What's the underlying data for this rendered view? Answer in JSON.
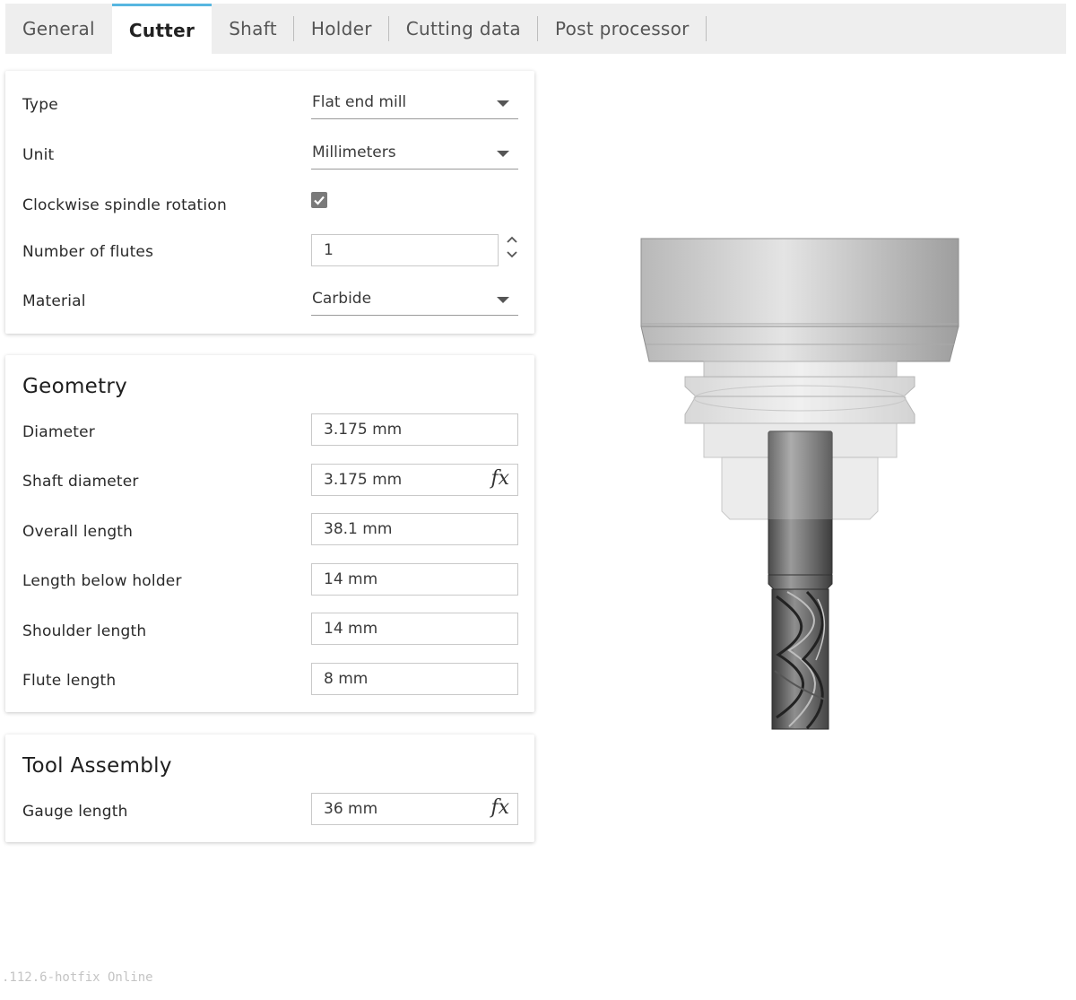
{
  "tabs": [
    {
      "label": "General"
    },
    {
      "label": "Cutter"
    },
    {
      "label": "Shaft"
    },
    {
      "label": "Holder"
    },
    {
      "label": "Cutting data"
    },
    {
      "label": "Post processor"
    }
  ],
  "active_tab": "Cutter",
  "cutter": {
    "type_label": "Type",
    "type_value": "Flat end mill",
    "unit_label": "Unit",
    "unit_value": "Millimeters",
    "cw_label": "Clockwise spindle rotation",
    "cw_checked": true,
    "flutes_label": "Number of flutes",
    "flutes_value": "1",
    "material_label": "Material",
    "material_value": "Carbide"
  },
  "geometry": {
    "title": "Geometry",
    "diameter_label": "Diameter",
    "diameter_value": "3.175 mm",
    "shaft_diameter_label": "Shaft diameter",
    "shaft_diameter_value": "3.175 mm",
    "overall_length_label": "Overall length",
    "overall_length_value": "38.1 mm",
    "length_below_holder_label": "Length below holder",
    "length_below_holder_value": "14 mm",
    "shoulder_length_label": "Shoulder length",
    "shoulder_length_value": "14 mm",
    "flute_length_label": "Flute length",
    "flute_length_value": "8 mm"
  },
  "assembly": {
    "title": "Tool Assembly",
    "gauge_length_label": "Gauge length",
    "gauge_length_value": "36 mm"
  },
  "fx_symbol": "fx",
  "footer": ".112.6-hotfix Online",
  "colors": {
    "accent": "#57b6e0",
    "tab_bg": "#eeeeee",
    "checkbox": "#7a7a7a"
  }
}
